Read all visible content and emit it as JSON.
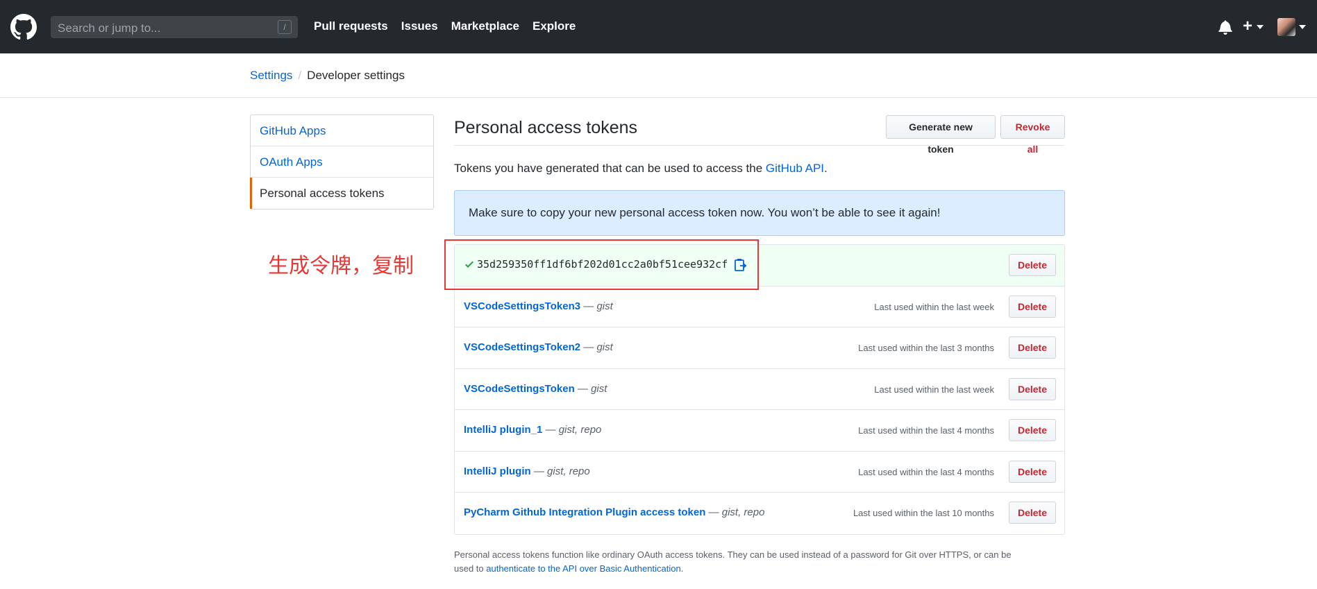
{
  "header": {
    "search_placeholder": "Search or jump to...",
    "search_key": "/",
    "nav": [
      "Pull requests",
      "Issues",
      "Marketplace",
      "Explore"
    ],
    "plus": "+"
  },
  "breadcrumb": {
    "parent": "Settings",
    "separator": "/",
    "current": "Developer settings"
  },
  "sidebar": {
    "items": [
      {
        "label": "GitHub Apps"
      },
      {
        "label": "OAuth Apps"
      },
      {
        "label": "Personal access tokens"
      }
    ]
  },
  "main": {
    "title": "Personal access tokens",
    "generate_label": "Generate new token",
    "revoke_label": "Revoke all",
    "description_prefix": "Tokens you have generated that can be used to access the ",
    "description_link": "GitHub API",
    "description_suffix": ".",
    "flash": "Make sure to copy your new personal access token now. You won’t be able to see it again!",
    "new_token": "35d259350ff1df6bf202d01cc2a0bf51cee932cf",
    "delete_label": "Delete",
    "tokens": [
      {
        "name": "VSCodeSettingsToken3",
        "dash": " — ",
        "scopes": "gist",
        "last_used": "Last used within the last week"
      },
      {
        "name": "VSCodeSettingsToken2",
        "dash": " — ",
        "scopes": "gist",
        "last_used": "Last used within the last 3 months"
      },
      {
        "name": "VSCodeSettingsToken",
        "dash": " — ",
        "scopes": "gist",
        "last_used": "Last used within the last week"
      },
      {
        "name": "IntelliJ plugin_1",
        "dash": " — ",
        "scopes": "gist, repo",
        "last_used": "Last used within the last 4 months"
      },
      {
        "name": "IntelliJ plugin",
        "dash": " — ",
        "scopes": "gist, repo",
        "last_used": "Last used within the last 4 months"
      },
      {
        "name": "PyCharm Github Integration Plugin access token",
        "dash": " — ",
        "scopes": "gist, repo",
        "last_used": "Last used within the last 10 months"
      }
    ],
    "footer_line1": "Personal access tokens function like ordinary OAuth access tokens. They can be used instead of a password for Git over HTTPS, or can be",
    "footer_prefix": "used to ",
    "footer_link": "authenticate to the API over Basic Authentication",
    "footer_suffix": "."
  },
  "annotation": {
    "text": "生成令牌，复制",
    "color": "#e53935"
  },
  "colors": {
    "header_bg": "#24292e",
    "link": "#0366d6",
    "danger": "#cb2431",
    "flash_bg": "#dbedff",
    "new_token_bg": "#f0fff4",
    "selected_accent": "#e36209"
  },
  "icons": [
    "github-logo-icon",
    "bell-icon",
    "plus-icon",
    "caret-down-icon",
    "check-icon",
    "clipboard-icon"
  ]
}
